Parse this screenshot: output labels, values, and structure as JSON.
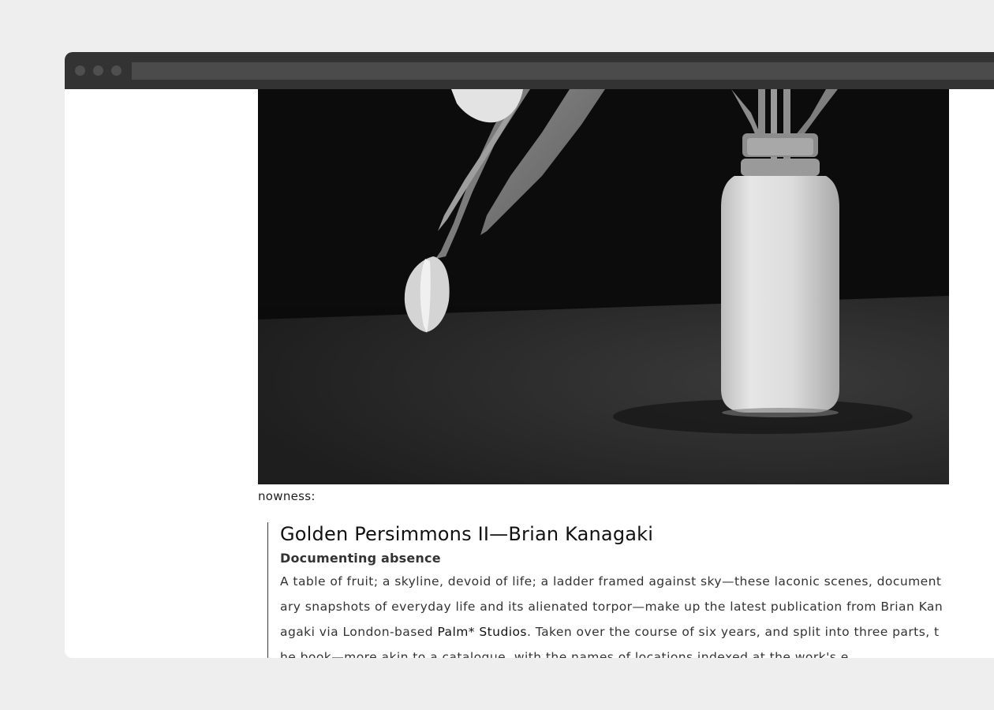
{
  "article": {
    "caption": "nowness:",
    "quote": {
      "title": "Golden Persimmons II—Brian Kanagaki",
      "subtitle": "Documenting absence",
      "body_before_link": "A table of fruit; a skyline, devoid of life; a ladder framed against sky—these laconic scenes, documentary snapshots of everyday life and its alienated torpor—make up the latest publication from Brian Kanagaki via London-based ",
      "link_text": "Palm* Studios",
      "body_after_link": ". Taken over the course of six years, and split into three parts, the book—more akin to a catalogue, with the names of locations indexed at the work's e"
    }
  },
  "colors": {
    "page_background": "#eeeeee",
    "titlebar": "#333333",
    "window_background": "#ffffff"
  }
}
